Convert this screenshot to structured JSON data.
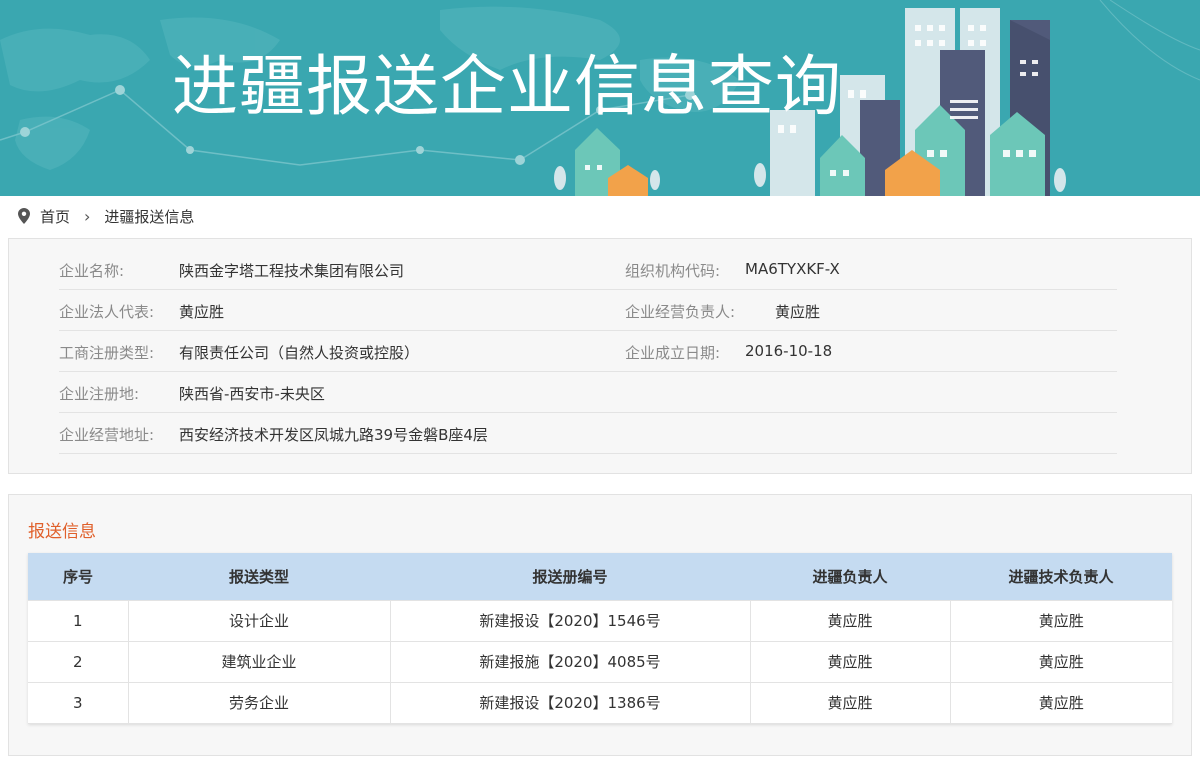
{
  "banner": {
    "title": "进疆报送企业信息查询"
  },
  "breadcrumb": {
    "home": "首页",
    "current": "进疆报送信息"
  },
  "company": {
    "name_label": "企业名称:",
    "name": "陕西金字塔工程技术集团有限公司",
    "org_code_label": "组织机构代码:",
    "org_code": "MA6TYXKF-X",
    "legal_rep_label": "企业法人代表:",
    "legal_rep": "黄应胜",
    "manager_label": "企业经营负责人:",
    "manager": "黄应胜",
    "reg_type_label": "工商注册类型:",
    "reg_type": "有限责任公司（自然人投资或控股）",
    "founded_label": "企业成立日期:",
    "founded": "2016-10-18",
    "reg_place_label": "企业注册地:",
    "reg_place": "陕西省-西安市-未央区",
    "address_label": "企业经营地址:",
    "address": "西安经济技术开发区凤城九路39号金磐B座4层"
  },
  "report": {
    "title": "报送信息",
    "columns": [
      "序号",
      "报送类型",
      "报送册编号",
      "进疆负责人",
      "进疆技术负责人"
    ],
    "rows": [
      [
        "1",
        "设计企业",
        "新建报设【2020】1546号",
        "黄应胜",
        "黄应胜"
      ],
      [
        "2",
        "建筑业企业",
        "新建报施【2020】4085号",
        "黄应胜",
        "黄应胜"
      ],
      [
        "3",
        "劳务企业",
        "新建报设【2020】1386号",
        "黄应胜",
        "黄应胜"
      ]
    ]
  },
  "colors": {
    "banner": "#3aa7b0",
    "accent": "#e0602b",
    "table_header": "#c5dbf1"
  }
}
